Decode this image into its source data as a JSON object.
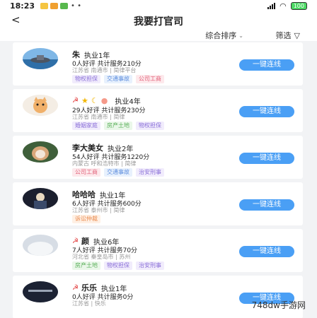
{
  "status": {
    "time": "18:23",
    "dots": "• •",
    "battery": "100"
  },
  "header": {
    "title": "我要打官司",
    "back": "<"
  },
  "filters": {
    "sort_label": "综合排序",
    "filter_label": "筛选"
  },
  "lawyers": [
    {
      "name": "朱",
      "years": "执业1年",
      "stats": "0人好评  共计服务210分",
      "location": "江苏省  南通市 | 简律平台",
      "tags": [
        {
          "text": "物权担保",
          "color": "purple"
        },
        {
          "text": "交通事故",
          "color": "blue"
        },
        {
          "text": "公司工商",
          "color": "pink"
        }
      ],
      "button": "一键连线"
    },
    {
      "name": "",
      "years": "执业4年",
      "stats": "29人好评  共计服务230分",
      "location": "江苏省  南通市 | 简律",
      "tags": [
        {
          "text": "婚姻家庭",
          "color": "purple"
        },
        {
          "text": "房产土地",
          "color": "green"
        },
        {
          "text": "物权担保",
          "color": "purple"
        }
      ],
      "button": "一键连线"
    },
    {
      "name": "李大美女",
      "years": "执业2年",
      "stats": "54人好评  共计服务1220分",
      "location": "内蒙古  呼和浩特市 | 简律",
      "tags": [
        {
          "text": "公司工商",
          "color": "pink"
        },
        {
          "text": "交通事故",
          "color": "blue"
        },
        {
          "text": "治安刑事",
          "color": "purple"
        }
      ],
      "button": "一键连线"
    },
    {
      "name": "哈哈哈",
      "years": "执业1年",
      "stats": "6人好评  共计服务600分",
      "location": "江苏省  泰州市 | 简律",
      "tags": [
        {
          "text": "诉讼仲裁",
          "color": "orange"
        }
      ],
      "button": "一键连线"
    },
    {
      "name": "颜",
      "years": "执业6年",
      "stats": "7人好评  共计服务70分",
      "location": "河北省  秦皇岛市 | 苏州",
      "tags": [
        {
          "text": "房产土地",
          "color": "green"
        },
        {
          "text": "物权担保",
          "color": "purple"
        },
        {
          "text": "治安刑事",
          "color": "purple"
        }
      ],
      "button": "一键连线"
    },
    {
      "name": "乐乐",
      "years": "执业1年",
      "stats": "0人好评  共计服务0分",
      "location": "江苏省  | 快乐",
      "tags": [],
      "button": "一键连线"
    }
  ],
  "watermark": "748dw手游网"
}
